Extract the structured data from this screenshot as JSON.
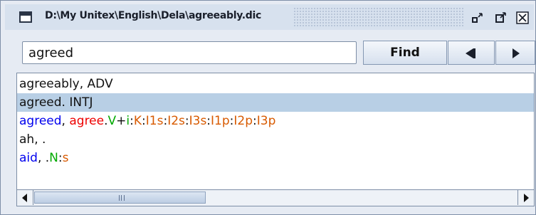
{
  "window": {
    "title": "D:\\My Unitex\\English\\Dela\\agreeably.dic",
    "buttons": {
      "minimize": "▫",
      "maximize": "◹",
      "close": "✕"
    }
  },
  "search": {
    "value": "agreed",
    "find_label": "Find",
    "prev_icon": "step-back-icon",
    "next_icon": "play-icon"
  },
  "entries": [
    {
      "segments": [
        {
          "text": "agreeably, ADV",
          "color": "black"
        }
      ],
      "selected": false
    },
    {
      "segments": [
        {
          "text": "agreed. INTJ",
          "color": "black"
        }
      ],
      "selected": true
    },
    {
      "segments": [
        {
          "text": "agreed",
          "color": "blue"
        },
        {
          "text": ", ",
          "color": "black"
        },
        {
          "text": "agree",
          "color": "red"
        },
        {
          "text": ".",
          "color": "black"
        },
        {
          "text": "V",
          "color": "green"
        },
        {
          "text": "+",
          "color": "black"
        },
        {
          "text": "i",
          "color": "green"
        },
        {
          "text": ":",
          "color": "black"
        },
        {
          "text": "K",
          "color": "orange"
        },
        {
          "text": ":",
          "color": "black"
        },
        {
          "text": "I1s",
          "color": "orange"
        },
        {
          "text": ":",
          "color": "black"
        },
        {
          "text": "I2s",
          "color": "orange"
        },
        {
          "text": ":",
          "color": "black"
        },
        {
          "text": "I3s",
          "color": "orange"
        },
        {
          "text": ":",
          "color": "black"
        },
        {
          "text": "I1p",
          "color": "orange"
        },
        {
          "text": ":",
          "color": "black"
        },
        {
          "text": "I2p",
          "color": "orange"
        },
        {
          "text": ":",
          "color": "black"
        },
        {
          "text": "I3p",
          "color": "orange"
        }
      ],
      "selected": false
    },
    {
      "segments": [
        {
          "text": "ah, .",
          "color": "black"
        }
      ],
      "selected": false
    },
    {
      "segments": [
        {
          "text": "aid",
          "color": "blue"
        },
        {
          "text": ", .",
          "color": "black"
        },
        {
          "text": "N",
          "color": "green"
        },
        {
          "text": ":",
          "color": "black"
        },
        {
          "text": "s",
          "color": "orange"
        }
      ],
      "selected": false
    }
  ],
  "colors": {
    "selection": "#b8cfe5",
    "blue": "#0000ee",
    "red": "#ee0000",
    "green": "#00aa00",
    "orange": "#d85a00"
  }
}
